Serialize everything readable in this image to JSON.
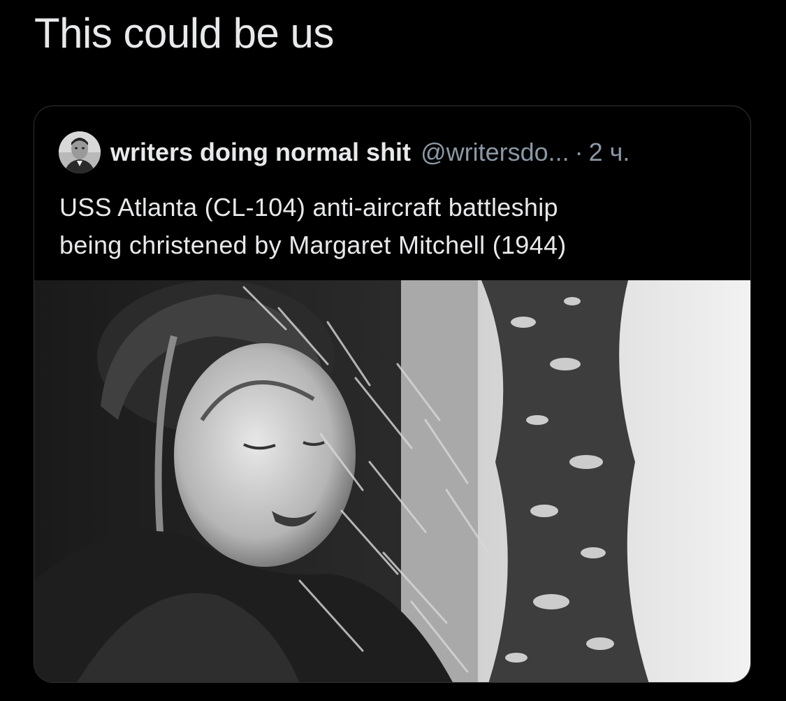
{
  "tweet": {
    "text": "This could be us"
  },
  "quoted_tweet": {
    "display_name": "writers doing normal shit",
    "handle": "@writersdo...",
    "separator": "·",
    "time": "2 ч.",
    "body_lines": [
      "USS Atlanta (CL-104) anti-aircraft battleship",
      "being christened by Margaret Mitchell (1944)"
    ],
    "avatar_icon": "profile-photo",
    "media": "black-and-white-photo"
  },
  "colors": {
    "background": "#000000",
    "primary_text": "#e7e9ea",
    "secondary_text": "#8b98a5",
    "card_border": "#2f3336"
  }
}
